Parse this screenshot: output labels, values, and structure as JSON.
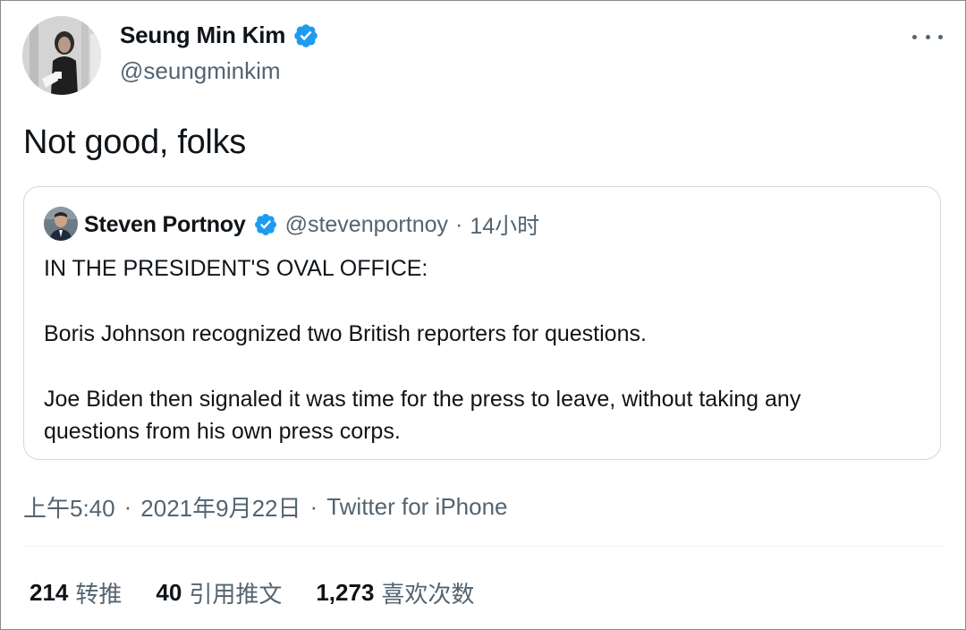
{
  "tweet": {
    "author": {
      "name": "Seung Min Kim",
      "handle": "@seungminkim",
      "verified": true
    },
    "text": "Not good, folks",
    "quote": {
      "author_name": "Steven Portnoy",
      "author_handle": "@stevenportnoy",
      "separator": "·",
      "time": "14小时",
      "paragraphs": [
        "IN THE PRESIDENT'S OVAL OFFICE:",
        "Boris Johnson recognized two British reporters for questions.",
        "Joe Biden then signaled it was time for the press to leave, without taking any",
        "questions from his own press corps."
      ]
    },
    "meta": {
      "time": "上午5:40",
      "separator": "·",
      "date": "2021年9月22日",
      "source": "Twitter for iPhone"
    },
    "stats": [
      {
        "count": "214",
        "label": "转推"
      },
      {
        "count": "40",
        "label": "引用推文"
      },
      {
        "count": "1,273",
        "label": "喜欢次数"
      }
    ]
  },
  "colors": {
    "text": "#0f1419",
    "secondary": "#536471",
    "verified_blue": "#1d9bf0",
    "border": "#cfd9de"
  },
  "icons": {
    "verified": "verified-badge-icon",
    "more": "more-options-icon"
  }
}
